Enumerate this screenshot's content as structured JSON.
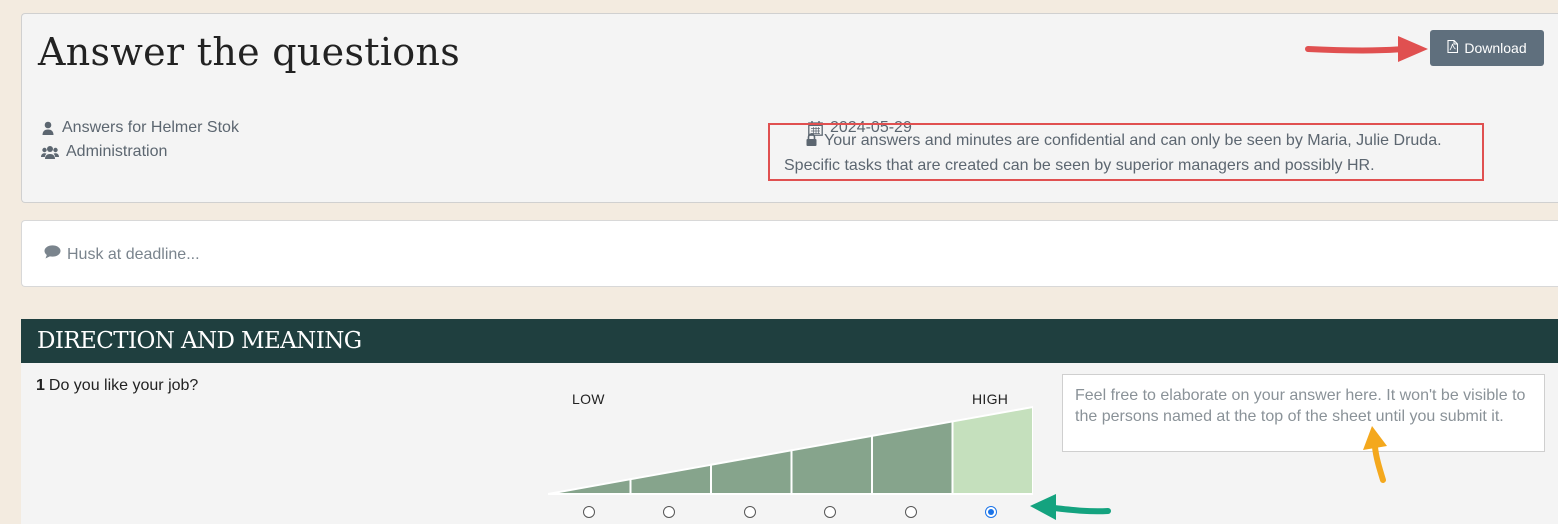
{
  "header": {
    "title": "Answer the questions",
    "download_label": "Download"
  },
  "meta": {
    "answers_for": "Answers for Helmer Stok",
    "department": "Administration",
    "date": "2024-05-29",
    "confidential_line1": "Your answers and minutes are confidential and can only be seen by Maria, Julie Druda.",
    "confidential_line2": "Specific tasks that are created can be seen by superior managers and possibly HR."
  },
  "reminder": {
    "label": "Husk at deadline..."
  },
  "section": {
    "title": "DIRECTION AND MEANING",
    "question": {
      "number": "1",
      "text": "Do you like your job?",
      "scale_low": "LOW",
      "scale_high": "HIGH",
      "scale_steps": 6,
      "selected_step": 6,
      "comment_placeholder": "Feel free to elaborate on your answer here. It won't be visible to the persons named at the top of the sheet until you submit it."
    }
  },
  "colors": {
    "page_bg": "#f3ebe0",
    "header_bg": "#1f3f3f",
    "scale_fill": "#86a48c",
    "scale_selected": "#c5e0bd",
    "download_bg": "#5f6f7d",
    "annotation_red": "#e05050",
    "annotation_green": "#14a37f",
    "annotation_orange": "#f4a81d"
  },
  "icons": [
    "user-icon",
    "users-icon",
    "calendar-icon",
    "lock-icon",
    "comment-icon",
    "pdf-file-icon"
  ]
}
